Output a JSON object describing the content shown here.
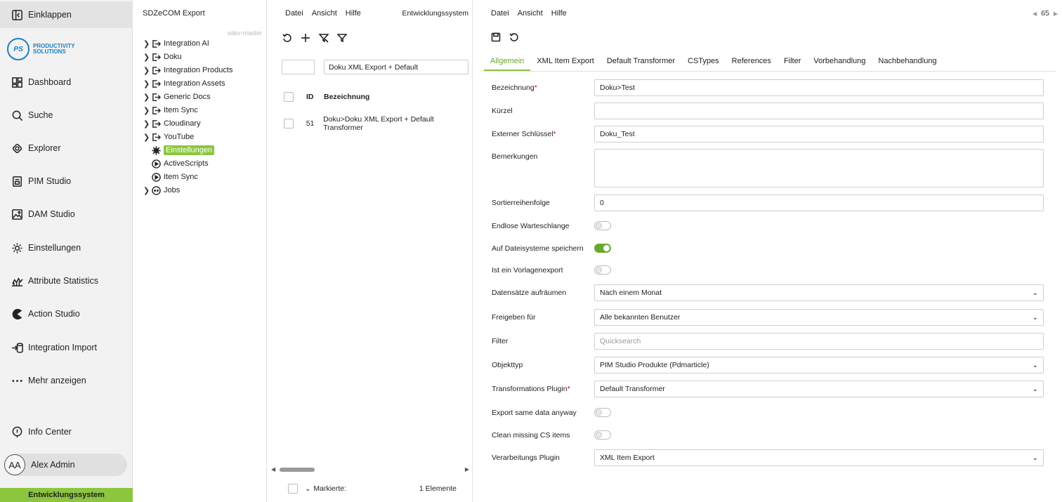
{
  "nav": {
    "collapse_label": "Einklappen",
    "logo_mark": "PS",
    "logo_text": "PRODUCTIVITY SOLUTIONS",
    "items": [
      {
        "label": "Dashboard",
        "icon": "dashboard-icon"
      },
      {
        "label": "Suche",
        "icon": "search-icon"
      },
      {
        "label": "Explorer",
        "icon": "explorer-icon"
      },
      {
        "label": "PIM Studio",
        "icon": "pim-studio-icon"
      },
      {
        "label": "DAM Studio",
        "icon": "image-icon"
      },
      {
        "label": "Einstellungen",
        "icon": "gear-icon"
      },
      {
        "label": "Attribute Statistics",
        "icon": "chart-icon"
      },
      {
        "label": "Action Studio",
        "icon": "pacman-icon"
      },
      {
        "label": "Integration Import",
        "icon": "import-icon"
      },
      {
        "label": "Mehr anzeigen",
        "icon": "more-icon"
      }
    ],
    "info_center": "Info Center",
    "user_initials": "AA",
    "user_name": "Alex Admin",
    "environment": "Entwicklungssystem",
    "environment_color": "#8cc63f"
  },
  "tree": {
    "title": "SDZeCOM Export",
    "branch": "vdev-master",
    "items": [
      {
        "label": "Integration AI"
      },
      {
        "label": "Doku"
      },
      {
        "label": "Integration Products"
      },
      {
        "label": "Integration Assets"
      },
      {
        "label": "Generic Docs"
      },
      {
        "label": "Item Sync"
      },
      {
        "label": "Cloudinary"
      },
      {
        "label": "YouTube"
      },
      {
        "label": "Einstellungen"
      },
      {
        "label": "ActiveScripts"
      },
      {
        "label": "Item Sync"
      },
      {
        "label": "Jobs"
      }
    ]
  },
  "list": {
    "menu": [
      "Datei",
      "Ansicht",
      "Hilfe"
    ],
    "environment": "Entwicklungssystem",
    "search_value": "Doku XML Export + Default",
    "columns": {
      "id": "ID",
      "name": "Bezeichnung"
    },
    "rows": [
      {
        "id": "51",
        "name": "Doku>Doku XML Export + Default Transformer"
      }
    ],
    "footer_label": "Markierte:",
    "footer_count": "1 Elemente"
  },
  "detail": {
    "menu": [
      "Datei",
      "Ansicht",
      "Hilfe"
    ],
    "pager": "65",
    "tabs": [
      "Allgemein",
      "XML Item Export",
      "Default Transformer",
      "CSTypes",
      "References",
      "Filter",
      "Vorbehandlung",
      "Nachbehandlung"
    ],
    "fields": {
      "bezeichnung": {
        "label": "Bezeichnung",
        "value": "Doku>Test"
      },
      "kuerzel": {
        "label": "Kürzel",
        "value": ""
      },
      "ext_key": {
        "label": "Externer Schlüssel",
        "value": "Doku_Test"
      },
      "bemerkungen": {
        "label": "Bemerkungen",
        "value": ""
      },
      "sort": {
        "label": "Sortierreihenfolge",
        "value": "0"
      },
      "endless": {
        "label": "Endlose Warteschlange",
        "on": false
      },
      "fs_save": {
        "label": "Auf Dateisysteme speichern",
        "on": true
      },
      "template": {
        "label": "Ist ein Vorlagenexport",
        "on": false
      },
      "cleanup": {
        "label": "Datensätze aufräumen",
        "value": "Nach einem Monat"
      },
      "share": {
        "label": "Freigeben für",
        "value": "Alle bekannten Benutzer"
      },
      "filter": {
        "label": "Filter",
        "placeholder": "Quicksearch"
      },
      "objtype": {
        "label": "Objekttyp",
        "value": "PIM Studio Produkte (Pdmarticle)"
      },
      "transform": {
        "label": "Transformations Plugin",
        "value": "Default Transformer"
      },
      "same_data": {
        "label": "Export same data anyway",
        "on": false
      },
      "clean_cs": {
        "label": "Clean missing CS items",
        "on": false
      },
      "processing": {
        "label": "Verarbeitungs Plugin",
        "value": "XML Item Export"
      }
    },
    "required_mark": "*",
    "accent_color": "#8cc63f"
  }
}
